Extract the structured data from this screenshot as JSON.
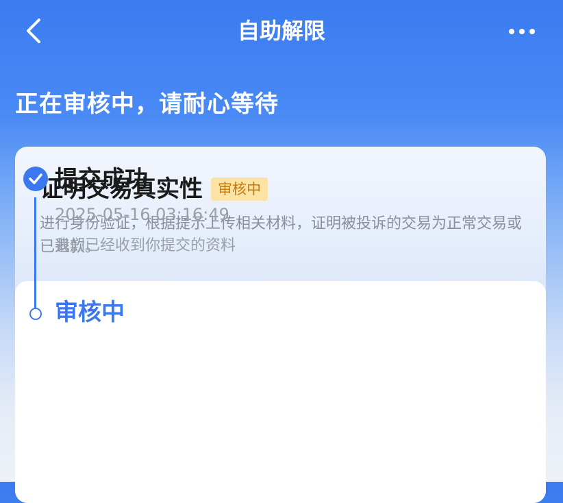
{
  "nav": {
    "title": "自助解限",
    "back_icon": "chevron-left-icon",
    "more_icon": "more-horizontal-icon"
  },
  "status_heading": "正在审核中，请耐心等待",
  "card": {
    "title": "证明交易真实性",
    "badge": "审核中",
    "description": "进行身份验证，根据提示上传相关材料，证明被投诉的交易为正常交易或已退款。"
  },
  "steps": [
    {
      "title": "提交成功",
      "time": "2025-05-16 03:16:49",
      "note": "我们已经收到你提交的资料",
      "state": "done",
      "icon": "check-circle-icon"
    },
    {
      "title": "审核中",
      "state": "pending",
      "icon": "circle-outline-icon"
    }
  ],
  "colors": {
    "primary": "#3b78f0",
    "badge_bg": "#fbe3a6",
    "badge_text": "#c57a0d"
  }
}
